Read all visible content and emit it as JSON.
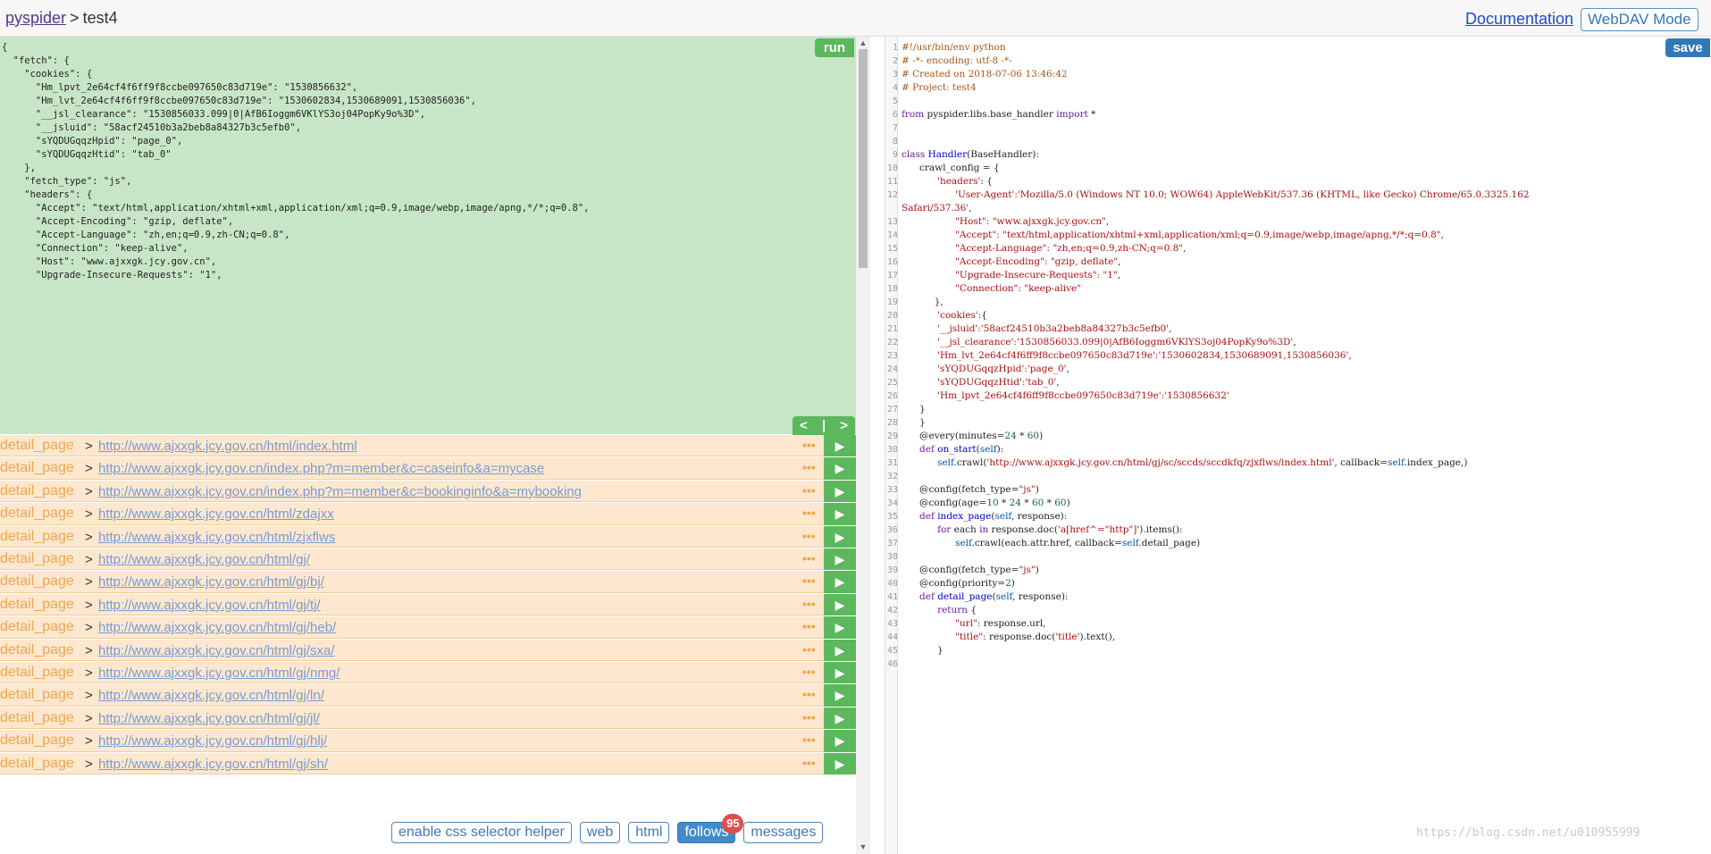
{
  "header": {
    "project_link": "pyspider",
    "separator": ">",
    "project_name": "test4",
    "documentation": "Documentation",
    "webdav": "WebDAV Mode"
  },
  "left": {
    "run_label": "run",
    "task_json": "{\n  \"fetch\": {\n    \"cookies\": {\n      \"Hm_lpvt_2e64cf4f6ff9f8ccbe097650c83d719e\": \"1530856632\",\n      \"Hm_lvt_2e64cf4f6ff9f8ccbe097650c83d719e\": \"1530602834,1530689091,1530856036\",\n      \"__jsl_clearance\": \"1530856033.099|0|AfB6Ioggm6VKlYS3oj04PopKy9o%3D\",\n      \"__jsluid\": \"58acf24510b3a2beb8a84327b3c5efb0\",\n      \"sYQDUGqqzHpid\": \"page_0\",\n      \"sYQDUGqqzHtid\": \"tab_0\"\n    },\n    \"fetch_type\": \"js\",\n    \"headers\": {\n      \"Accept\": \"text/html,application/xhtml+xml,application/xml;q=0.9,image/webp,image/apng,*/*;q=0.8\",\n      \"Accept-Encoding\": \"gzip, deflate\",\n      \"Accept-Language\": \"zh,en;q=0.9,zh-CN;q=0.8\",\n      \"Connection\": \"keep-alive\",\n      \"Host\": \"www.ajxxgk.jcy.gov.cn\",\n      \"Upgrade-Insecure-Requests\": \"1\",",
    "pager_prev": "<",
    "pager_sep": "|",
    "pager_next": ">",
    "follows": [
      {
        "callback": "detail_page",
        "url": "http://www.ajxxgk.jcy.gov.cn/html/index.html"
      },
      {
        "callback": "detail_page",
        "url": "http://www.ajxxgk.jcy.gov.cn/index.php?m=member&c=caseinfo&a=mycase"
      },
      {
        "callback": "detail_page",
        "url": "http://www.ajxxgk.jcy.gov.cn/index.php?m=member&c=bookinginfo&a=mybooking"
      },
      {
        "callback": "detail_page",
        "url": "http://www.ajxxgk.jcy.gov.cn/html/zdajxx"
      },
      {
        "callback": "detail_page",
        "url": "http://www.ajxxgk.jcy.gov.cn/html/zjxflws"
      },
      {
        "callback": "detail_page",
        "url": "http://www.ajxxgk.jcy.gov.cn/html/gj/"
      },
      {
        "callback": "detail_page",
        "url": "http://www.ajxxgk.jcy.gov.cn/html/gj/bj/"
      },
      {
        "callback": "detail_page",
        "url": "http://www.ajxxgk.jcy.gov.cn/html/gj/tj/"
      },
      {
        "callback": "detail_page",
        "url": "http://www.ajxxgk.jcy.gov.cn/html/gj/heb/"
      },
      {
        "callback": "detail_page",
        "url": "http://www.ajxxgk.jcy.gov.cn/html/gj/sxa/"
      },
      {
        "callback": "detail_page",
        "url": "http://www.ajxxgk.jcy.gov.cn/html/gj/nmg/"
      },
      {
        "callback": "detail_page",
        "url": "http://www.ajxxgk.jcy.gov.cn/html/gj/ln/"
      },
      {
        "callback": "detail_page",
        "url": "http://www.ajxxgk.jcy.gov.cn/html/gj/jl/"
      },
      {
        "callback": "detail_page",
        "url": "http://www.ajxxgk.jcy.gov.cn/html/gj/hlj/"
      },
      {
        "callback": "detail_page",
        "url": "http://www.ajxxgk.jcy.gov.cn/html/gj/sh/"
      }
    ],
    "row_separator": ">",
    "row_more": "•••",
    "row_play": "▶",
    "tabs": {
      "css_helper": "enable css selector helper",
      "web": "web",
      "html": "html",
      "follows": "follows",
      "follows_count": "95",
      "messages": "messages"
    }
  },
  "editor": {
    "save_label": "save",
    "line_numbers": "1\n2\n3\n4\n5\n6\n7\n8\n9\n10\n11\n12\n\n13\n14\n15\n16\n17\n18\n19\n20\n21\n22\n23\n24\n25\n26\n27\n28\n29\n30\n31\n32\n33\n34\n35\n36\n37\n38\n39\n40\n41\n42\n43\n44\n45\n46",
    "code_lines": [
      [
        [
          "c",
          "#!/usr/bin/env python"
        ]
      ],
      [
        [
          "c",
          "# -*- encoding: utf-8 -*-"
        ]
      ],
      [
        [
          "c",
          "# Created on 2018-07-06 13:46:42"
        ]
      ],
      [
        [
          "c",
          "# Project: test4"
        ]
      ],
      [],
      [
        [
          "k",
          "from"
        ],
        [
          "t",
          " pyspider.libs.base_handler "
        ],
        [
          "k",
          "import"
        ],
        [
          "t",
          " *"
        ]
      ],
      [],
      [],
      [
        [
          "k",
          "class"
        ],
        [
          "t",
          " "
        ],
        [
          "d",
          "Handler"
        ],
        [
          "t",
          "(BaseHandler):"
        ]
      ],
      [
        [
          "t",
          "      crawl_config = {"
        ]
      ],
      [
        [
          "t",
          "            "
        ],
        [
          "s",
          "'headers'"
        ],
        [
          "t",
          ": {"
        ]
      ],
      [
        [
          "t",
          "                  "
        ],
        [
          "s",
          "'User-Agent':'Mozilla/5.0 (Windows NT 10.0; WOW64) AppleWebKit/537.36 (KHTML, like Gecko) Chrome/65.0.3325.162"
        ]
      ],
      [
        [
          "s",
          "Safari/537.36'"
        ],
        [
          "t",
          ","
        ]
      ],
      [
        [
          "t",
          "                  "
        ],
        [
          "s",
          "\"Host\": \"www.ajxxgk.jcy.gov.cn\""
        ],
        [
          "t",
          ","
        ]
      ],
      [
        [
          "t",
          "                  "
        ],
        [
          "s",
          "\"Accept\": \"text/html,application/xhtml+xml,application/xml;q=0.9,image/webp,image/apng,*/*;q=0.8\""
        ],
        [
          "t",
          ","
        ]
      ],
      [
        [
          "t",
          "                  "
        ],
        [
          "s",
          "\"Accept-Language\": \"zh,en;q=0.9,zh-CN;q=0.8\""
        ],
        [
          "t",
          ","
        ]
      ],
      [
        [
          "t",
          "                  "
        ],
        [
          "s",
          "\"Accept-Encoding\": \"gzip, deflate\""
        ],
        [
          "t",
          ","
        ]
      ],
      [
        [
          "t",
          "                  "
        ],
        [
          "s",
          "\"Upgrade-Insecure-Requests\": \"1\""
        ],
        [
          "t",
          ","
        ]
      ],
      [
        [
          "t",
          "                  "
        ],
        [
          "s",
          "\"Connection\": \"keep-alive\""
        ]
      ],
      [
        [
          "t",
          "           },"
        ]
      ],
      [
        [
          "t",
          "            "
        ],
        [
          "s",
          "'cookies'"
        ],
        [
          "t",
          ":{"
        ]
      ],
      [
        [
          "t",
          "            "
        ],
        [
          "s",
          "'__jsluid':'58acf24510b3a2beb8a84327b3c5efb0'"
        ],
        [
          "t",
          ","
        ]
      ],
      [
        [
          "t",
          "            "
        ],
        [
          "s",
          "'__jsl_clearance':'1530856033.099|0|AfB6Ioggm6VKlYS3oj04PopKy9o%3D'"
        ],
        [
          "t",
          ","
        ]
      ],
      [
        [
          "t",
          "            "
        ],
        [
          "s",
          "'Hm_lvt_2e64cf4f6ff9f8ccbe097650c83d719e':'1530602834,1530689091,1530856036'"
        ],
        [
          "t",
          ","
        ]
      ],
      [
        [
          "t",
          "            "
        ],
        [
          "s",
          "'sYQDUGqqzHpid':'page_0'"
        ],
        [
          "t",
          ","
        ]
      ],
      [
        [
          "t",
          "            "
        ],
        [
          "s",
          "'sYQDUGqqzHtid':'tab_0'"
        ],
        [
          "t",
          ","
        ]
      ],
      [
        [
          "t",
          "            "
        ],
        [
          "s",
          "'Hm_lpvt_2e64cf4f6ff9f8ccbe097650c83d719e':'1530856632'"
        ]
      ],
      [
        [
          "t",
          "      }"
        ]
      ],
      [
        [
          "t",
          "      }"
        ]
      ],
      [
        [
          "t",
          "      @every(minutes="
        ],
        [
          "n",
          "24"
        ],
        [
          "t",
          " * "
        ],
        [
          "n",
          "60"
        ],
        [
          "t",
          ")"
        ]
      ],
      [
        [
          "t",
          "      "
        ],
        [
          "k",
          "def"
        ],
        [
          "t",
          " "
        ],
        [
          "d",
          "on_start"
        ],
        [
          "t",
          "("
        ],
        [
          "v",
          "self"
        ],
        [
          "t",
          "):"
        ]
      ],
      [
        [
          "t",
          "            "
        ],
        [
          "v",
          "self"
        ],
        [
          "t",
          ".crawl("
        ],
        [
          "s",
          "'http://www.ajxxgk.jcy.gov.cn/html/gj/sc/sccds/sccdkfq/zjxflws/index.html'"
        ],
        [
          "t",
          ", callback="
        ],
        [
          "v",
          "self"
        ],
        [
          "t",
          ".index_page,)"
        ]
      ],
      [],
      [
        [
          "t",
          "      @config(fetch_type="
        ],
        [
          "s",
          "\"js\""
        ],
        [
          "t",
          ")"
        ]
      ],
      [
        [
          "t",
          "      @config(age="
        ],
        [
          "n",
          "10"
        ],
        [
          "t",
          " * "
        ],
        [
          "n",
          "24"
        ],
        [
          "t",
          " * "
        ],
        [
          "n",
          "60"
        ],
        [
          "t",
          " * "
        ],
        [
          "n",
          "60"
        ],
        [
          "t",
          ")"
        ]
      ],
      [
        [
          "t",
          "      "
        ],
        [
          "k",
          "def"
        ],
        [
          "t",
          " "
        ],
        [
          "d",
          "index_page"
        ],
        [
          "t",
          "("
        ],
        [
          "v",
          "self"
        ],
        [
          "t",
          ", response):"
        ]
      ],
      [
        [
          "t",
          "            "
        ],
        [
          "k",
          "for"
        ],
        [
          "t",
          " each "
        ],
        [
          "k",
          "in"
        ],
        [
          "t",
          " response.doc("
        ],
        [
          "s",
          "'a[href^=\"http\"]'"
        ],
        [
          "t",
          ").items():"
        ]
      ],
      [
        [
          "t",
          "                  "
        ],
        [
          "v",
          "self"
        ],
        [
          "t",
          ".crawl(each.attr.href, callback="
        ],
        [
          "v",
          "self"
        ],
        [
          "t",
          ".detail_page)"
        ]
      ],
      [],
      [
        [
          "t",
          "      @config(fetch_type="
        ],
        [
          "s",
          "\"js\""
        ],
        [
          "t",
          ")"
        ]
      ],
      [
        [
          "t",
          "      @config(priority="
        ],
        [
          "n",
          "2"
        ],
        [
          "t",
          ")"
        ]
      ],
      [
        [
          "t",
          "      "
        ],
        [
          "k",
          "def"
        ],
        [
          "t",
          " "
        ],
        [
          "d",
          "detail_page"
        ],
        [
          "t",
          "("
        ],
        [
          "v",
          "self"
        ],
        [
          "t",
          ", response):"
        ]
      ],
      [
        [
          "t",
          "            "
        ],
        [
          "k",
          "return"
        ],
        [
          "t",
          " {"
        ]
      ],
      [
        [
          "t",
          "                  "
        ],
        [
          "s",
          "\"url\""
        ],
        [
          "t",
          ": response.url,"
        ]
      ],
      [
        [
          "t",
          "                  "
        ],
        [
          "s",
          "\"title\""
        ],
        [
          "t",
          ": response.doc("
        ],
        [
          "s",
          "'title'"
        ],
        [
          "t",
          ").text(),"
        ]
      ],
      [
        [
          "t",
          "            }"
        ]
      ],
      []
    ]
  },
  "watermark": "https://blog.csdn.net/u010955999"
}
